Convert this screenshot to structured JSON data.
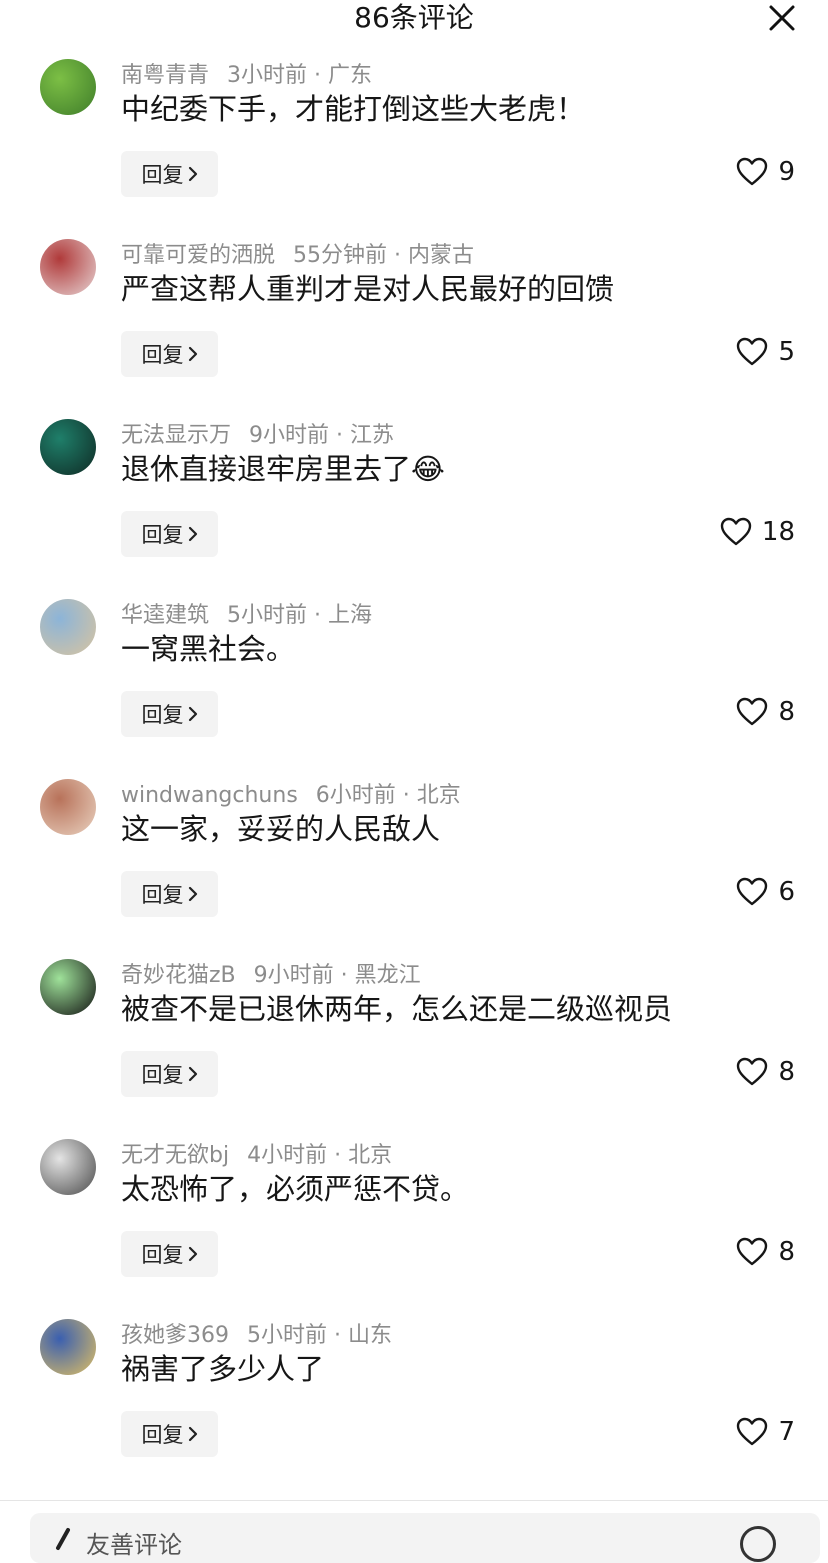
{
  "header": {
    "title": "86条评论"
  },
  "reply_label": "回复",
  "comments": [
    {
      "user": "南粤青青",
      "time": "3小时前",
      "location": "广东",
      "text": "中纪委下手，才能打倒这些大老虎！",
      "likes": "9",
      "avatar_colors": [
        "#7cbf45",
        "#3f7d2a"
      ]
    },
    {
      "user": "可靠可爱的洒脱",
      "time": "55分钟前",
      "location": "内蒙古",
      "text": "严查这帮人重判才是对人民最好的回馈",
      "likes": "5",
      "avatar_colors": [
        "#b03a3a",
        "#e6d3d3"
      ]
    },
    {
      "user": "无法显示万",
      "time": "9小时前",
      "location": "江苏",
      "text": "退休直接退牢房里去了",
      "emoji": "😂",
      "likes": "18",
      "avatar_colors": [
        "#1f7f6a",
        "#0f2a24"
      ]
    },
    {
      "user": "华逵建筑",
      "time": "5小时前",
      "location": "上海",
      "text": "一窝黑社会。",
      "likes": "8",
      "avatar_colors": [
        "#8cb4d8",
        "#d8c4a0"
      ]
    },
    {
      "user": "windwangchuns",
      "time": "6小时前",
      "location": "北京",
      "text": "这一家，妥妥的人民敌人",
      "likes": "6",
      "avatar_colors": [
        "#b8725a",
        "#e9d2c0"
      ]
    },
    {
      "user": "奇妙花猫zB",
      "time": "9小时前",
      "location": "黑龙江",
      "text": "被查不是已退休两年，怎么还是二级巡视员",
      "likes": "8",
      "avatar_colors": [
        "#9fe29a",
        "#111111"
      ]
    },
    {
      "user": "无才无欲bj",
      "time": "4小时前",
      "location": "北京",
      "text": "太恐怖了，必须严惩不贷。",
      "likes": "8",
      "avatar_colors": [
        "#e4e4e4",
        "#4a4a4a"
      ]
    },
    {
      "user": "孩她爹369",
      "time": "5小时前",
      "location": "山东",
      "text": "祸害了多少人了",
      "likes": "7",
      "avatar_colors": [
        "#3a5fb0",
        "#e0c062"
      ]
    }
  ],
  "input": {
    "placeholder": "友善评论"
  },
  "icons": {
    "close": "close-icon",
    "reply": "chevron-right-icon",
    "like": "heart-outline-icon",
    "input": "pencil-icon",
    "emoji": "emoji-icon"
  }
}
